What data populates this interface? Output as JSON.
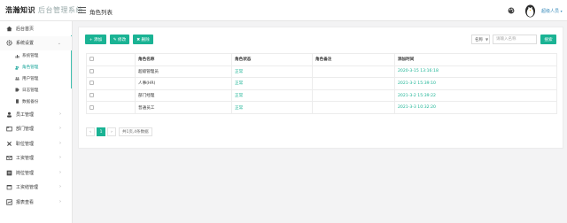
{
  "header": {
    "logo_main": "浩瀚知识",
    "logo_sub": "后台管理系统",
    "page_title": "角色列表",
    "user_name": "超级人员"
  },
  "sidebar": {
    "items": [
      {
        "label": "后台首页",
        "icon": "home-icon"
      },
      {
        "label": "系统设置",
        "icon": "gear-icon",
        "open": true,
        "children": [
          {
            "label": "系统管理",
            "icon": "bar-chart-icon"
          },
          {
            "label": "角色管理",
            "icon": "users-icon",
            "active": true
          },
          {
            "label": "用户管理",
            "icon": "user-group-icon"
          },
          {
            "label": "日志管理",
            "icon": "tag-icon"
          },
          {
            "label": "数据备份",
            "icon": "file-icon"
          }
        ]
      },
      {
        "label": "员工管理",
        "icon": "person-icon"
      },
      {
        "label": "部门管理",
        "icon": "folder-icon"
      },
      {
        "label": "职位管理",
        "icon": "cog-icon"
      },
      {
        "label": "工资管理",
        "icon": "mail-icon"
      },
      {
        "label": "岗位管理",
        "icon": "table-icon"
      },
      {
        "label": "工资结管理",
        "icon": "calendar-icon"
      },
      {
        "label": "报表查看",
        "icon": "chart-icon"
      }
    ]
  },
  "toolbar": {
    "add_label": "+ 添加",
    "edit_label": "✎ 修改",
    "delete_label": "✖ 删除",
    "select_value": "名称",
    "search_placeholder": "请输入名称",
    "search_label": "搜索"
  },
  "table": {
    "headers": [
      "",
      "角色名称",
      "角色状态",
      "角色备注",
      "添加时间"
    ],
    "rows": [
      {
        "name": "超级管理员",
        "status": "正常",
        "remark": "",
        "time": "2020-3-15 13:16:18"
      },
      {
        "name": "人事(HR)",
        "status": "正常",
        "remark": "",
        "time": "2021-3-2 15:39:10"
      },
      {
        "name": "部门经理",
        "status": "正常",
        "remark": "",
        "time": "2021-3-2 15:39:22"
      },
      {
        "name": "普通员工",
        "status": "正常",
        "remark": "",
        "time": "2021-3-3 10:32:20"
      }
    ]
  },
  "pagination": {
    "prev": "‹",
    "current": "1",
    "next": "›",
    "info": "共1页,4条数据"
  },
  "colors": {
    "accent": "#1ab394",
    "link": "#3c8dbc"
  }
}
